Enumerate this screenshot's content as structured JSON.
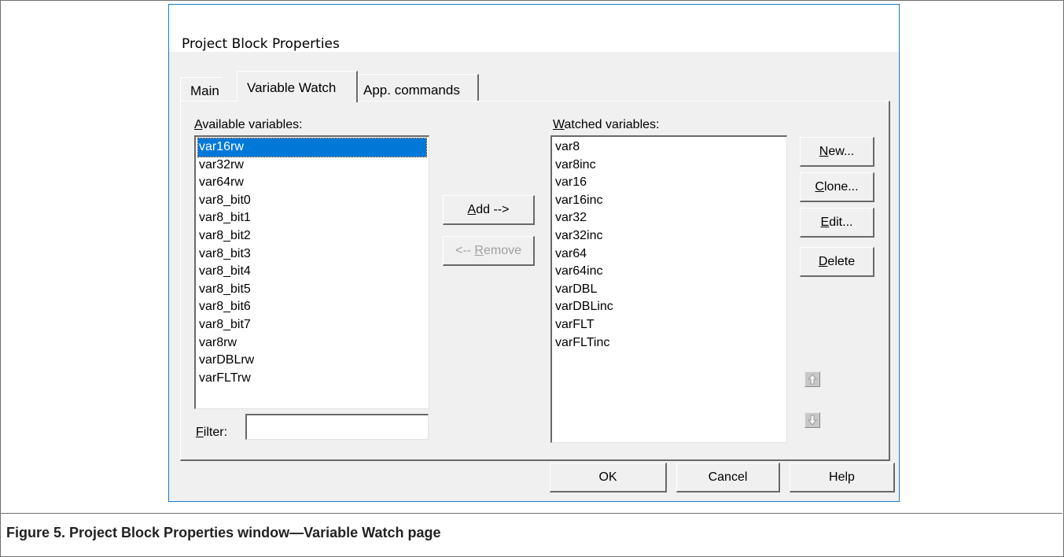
{
  "window": {
    "title": "Project Block Properties"
  },
  "tabs": [
    {
      "label": "Main",
      "active": false
    },
    {
      "label": "Variable Watch",
      "active": true
    },
    {
      "label": "App. commands",
      "active": false
    }
  ],
  "available": {
    "label_accel": "A",
    "label_rest": "vailable variables:",
    "items": [
      "var16rw",
      "var32rw",
      "var64rw",
      "var8_bit0",
      "var8_bit1",
      "var8_bit2",
      "var8_bit3",
      "var8_bit4",
      "var8_bit5",
      "var8_bit6",
      "var8_bit7",
      "var8rw",
      "varDBLrw",
      "varFLTrw"
    ],
    "selected": "var16rw"
  },
  "watched": {
    "label_accel": "W",
    "label_rest": "atched variables:",
    "items": [
      "var8",
      "var8inc",
      "var16",
      "var16inc",
      "var32",
      "var32inc",
      "var64",
      "var64inc",
      "varDBL",
      "varDBLinc",
      "varFLT",
      "varFLTinc"
    ]
  },
  "filter": {
    "label_accel": "F",
    "label_rest": "ilter:",
    "value": ""
  },
  "middle_buttons": {
    "add_accel": "A",
    "add_rest": "dd -->",
    "remove_prefix": "<-- ",
    "remove_accel": "R",
    "remove_rest": "emove"
  },
  "side_buttons": {
    "new_accel": "N",
    "new_rest": "ew...",
    "clone_accel": "C",
    "clone_rest": "lone...",
    "edit_accel": "E",
    "edit_rest": "dit...",
    "delete_accel": "D",
    "delete_rest": "elete"
  },
  "icons": {
    "move_up": "arrow-up-icon",
    "move_down": "arrow-down-icon"
  },
  "footer": {
    "ok": "OK",
    "cancel": "Cancel",
    "help": "Help"
  },
  "caption": "Figure 5. Project Block Properties window—Variable Watch page",
  "colors": {
    "selection": "#0078d7",
    "dialog_bg": "#f0f0f0",
    "dialog_border": "#1979ca"
  }
}
